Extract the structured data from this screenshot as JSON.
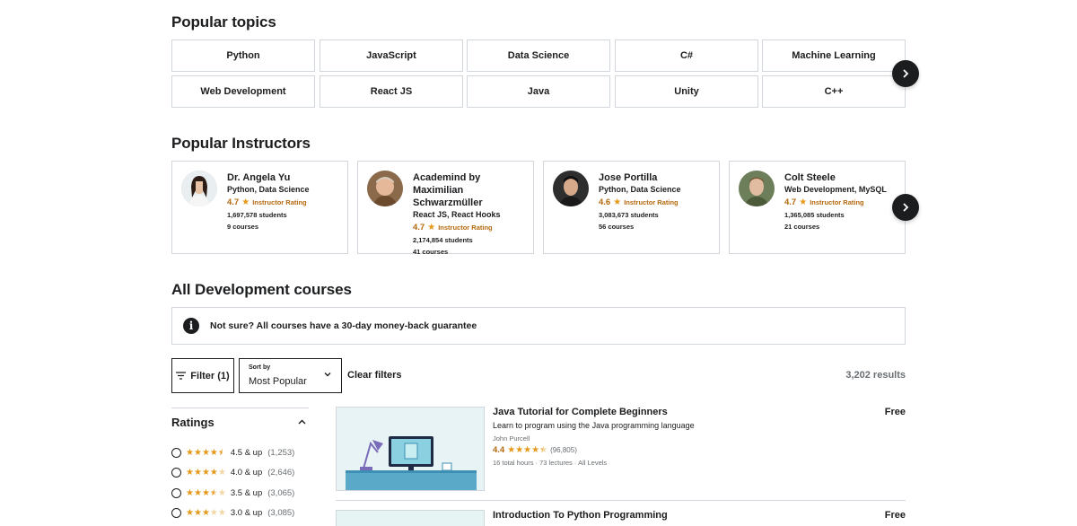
{
  "topics": {
    "title": "Popular topics",
    "items": [
      "Python",
      "JavaScript",
      "Data Science",
      "C#",
      "Machine Learning",
      "Web Development",
      "React JS",
      "Java",
      "Unity",
      "C++"
    ]
  },
  "instructors": {
    "title": "Popular Instructors",
    "rating_label": "Instructor Rating",
    "items": [
      {
        "name": "Dr. Angela Yu",
        "skills": "Python, Data Science",
        "rating": "4.7",
        "students": "1,697,578 students",
        "courses": "9 courses"
      },
      {
        "name": "Academind by Maximilian Schwarzmüller",
        "skills": "React JS, React Hooks",
        "rating": "4.7",
        "students": "2,174,854 students",
        "courses": "41 courses"
      },
      {
        "name": "Jose Portilla",
        "skills": "Python, Data Science",
        "rating": "4.6",
        "students": "3,083,673 students",
        "courses": "56 courses"
      },
      {
        "name": "Colt Steele",
        "skills": "Web Development, MySQL",
        "rating": "4.7",
        "students": "1,365,085 students",
        "courses": "21 courses"
      }
    ]
  },
  "courses_section": {
    "title": "All Development courses",
    "guarantee": "Not sure? All courses have a 30-day money-back guarantee",
    "filter_label": "Filter (1)",
    "sort_label": "Sort by",
    "sort_value": "Most Popular",
    "clear_filters": "Clear filters",
    "results": "3,202 results"
  },
  "ratings_filter": {
    "title": "Ratings",
    "options": [
      {
        "label": "4.5 & up",
        "count": "(1,253)",
        "stars": 4.5
      },
      {
        "label": "4.0 & up",
        "count": "(2,646)",
        "stars": 4.0
      },
      {
        "label": "3.5 & up",
        "count": "(3,065)",
        "stars": 3.5
      },
      {
        "label": "3.0 & up",
        "count": "(3,085)",
        "stars": 3.0
      }
    ]
  },
  "courses": [
    {
      "title": "Java Tutorial for Complete Beginners",
      "desc": "Learn to program using the Java programming language",
      "author": "John Purcell",
      "rating": "4.4",
      "reviews": "(96,805)",
      "hours": "16 total hours",
      "lectures": "73 lectures",
      "level": "All Levels",
      "price": "Free"
    },
    {
      "title": "Introduction To Python Programming",
      "price": "Free"
    }
  ],
  "colors": {
    "accent": "#b4690e",
    "star": "#e59819",
    "dark": "#1c1d1f",
    "border": "#d1d7dc"
  }
}
